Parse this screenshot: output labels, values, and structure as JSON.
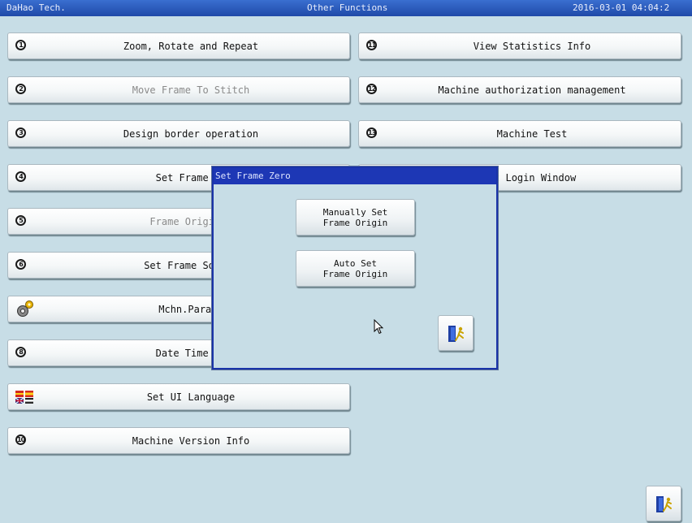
{
  "header": {
    "company": "DaHao Tech.",
    "title": "Other Functions",
    "datetime": "2016-03-01 04:04:2"
  },
  "menu_left": [
    {
      "num": "1",
      "label": "Zoom, Rotate and Repeat",
      "enabled": true
    },
    {
      "num": "2",
      "label": "Move Frame To Stitch",
      "enabled": false
    },
    {
      "num": "3",
      "label": "Design border operation",
      "enabled": true
    },
    {
      "num": "4",
      "label": "Set Frame Or",
      "enabled": true
    },
    {
      "num": "5",
      "label": "Frame Origin R",
      "enabled": false
    },
    {
      "num": "6",
      "label": "Set Frame Soft F",
      "enabled": true
    },
    {
      "icon": "gear-icon",
      "label": "Mchn.Para S",
      "enabled": true
    },
    {
      "num": "8",
      "label": "Date Time Co",
      "enabled": true
    },
    {
      "icon": "flag-icon",
      "label": "Set UI Language",
      "enabled": true
    },
    {
      "num": "10",
      "label": "Machine Version Info",
      "enabled": true
    }
  ],
  "menu_right": [
    {
      "num": "11",
      "label": "View Statistics Info"
    },
    {
      "num": "12",
      "label": "Machine authorization management"
    },
    {
      "num": "13",
      "label": "Machine Test"
    },
    {
      "label": "et Login Window"
    }
  ],
  "dialog": {
    "title": "Set Frame Zero",
    "manual_line1": "Manually Set",
    "manual_line2": "Frame Origin",
    "auto_line1": "Auto Set",
    "auto_line2": "Frame Origin",
    "exit_icon": "exit-door-icon"
  },
  "exit_icon": "exit-door-icon"
}
